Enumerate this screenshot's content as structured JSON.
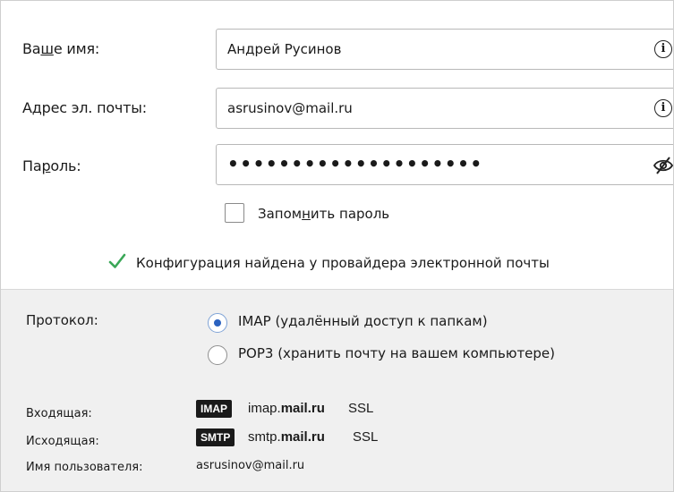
{
  "form": {
    "name": {
      "label_pre": "Ва",
      "label_acc": "ш",
      "label_post": "е имя:",
      "value": "Андрей Русинов"
    },
    "email": {
      "label": "Адрес эл. почты:",
      "value": "asrusinov@mail.ru"
    },
    "password": {
      "label_pre": "Па",
      "label_acc": "р",
      "label_post": "оль:",
      "value": "••••••••••••••••••••"
    },
    "remember": {
      "label_pre": "Запом",
      "label_acc": "н",
      "label_post": "ить пароль",
      "checked": false
    }
  },
  "status": {
    "text": "Конфигурация найдена у провайдера электронной почты",
    "icon": "checkmark-icon",
    "color": "#3aa757"
  },
  "protocol": {
    "label": "Протокол:",
    "options": [
      {
        "label": "IMAP (удалённый доступ к папкам)",
        "selected": true
      },
      {
        "label": "POP3 (хранить почту на вашем компьютере)",
        "selected": false
      }
    ]
  },
  "servers": {
    "incoming": {
      "label": "Входящая:",
      "badge": "IMAP",
      "host_prefix": "imap.",
      "host_bold": "mail.ru",
      "security": "SSL"
    },
    "outgoing": {
      "label": "Исходящая:",
      "badge": "SMTP",
      "host_prefix": "smtp.",
      "host_bold": "mail.ru",
      "security": "SSL"
    },
    "username": {
      "label": "Имя пользователя:",
      "value": "asrusinov@mail.ru"
    }
  },
  "colors": {
    "accent": "#2b62c0",
    "panel_bg": "#f0f0f0",
    "badge_bg": "#1a1a1a"
  }
}
